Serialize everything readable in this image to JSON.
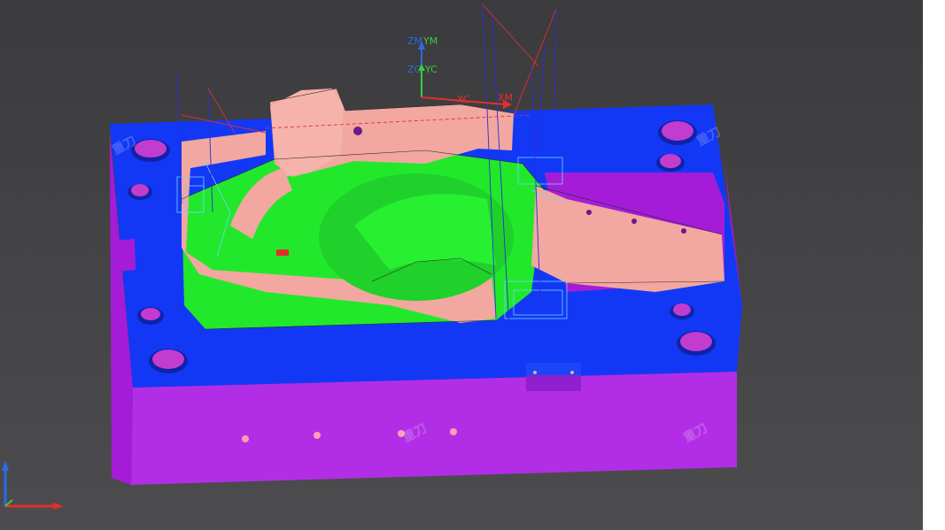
{
  "viewport": {
    "background_top": "#3b3b3d",
    "background_bottom": "#4c4c4e"
  },
  "colors": {
    "plate_blue": "#1338f5",
    "plate_side_magenta": "#a41cd8",
    "plate_front_magenta": "#b22ee6",
    "bore_magenta": "#c23ccf",
    "part_salmon": "#f2a7a0",
    "cavity_green": "#22e82b",
    "axis_red": "#e62d2d",
    "axis_green": "#3fc93f",
    "axis_blue": "#2a6be0",
    "wire_cyan": "#6fd4ff",
    "pin_pink": "#ff9fb0"
  },
  "wcs_triad": {
    "zm_label": "ZM",
    "ym_label": "YM",
    "zc_label": "ZC",
    "yc_label": "YC",
    "xc_label": "XC",
    "xm_label": "XM"
  },
  "corner_triad": {
    "icon": "view-triad-icon"
  },
  "watermark": {
    "icon": "brand-watermark-icon",
    "glyph": "重刀"
  }
}
